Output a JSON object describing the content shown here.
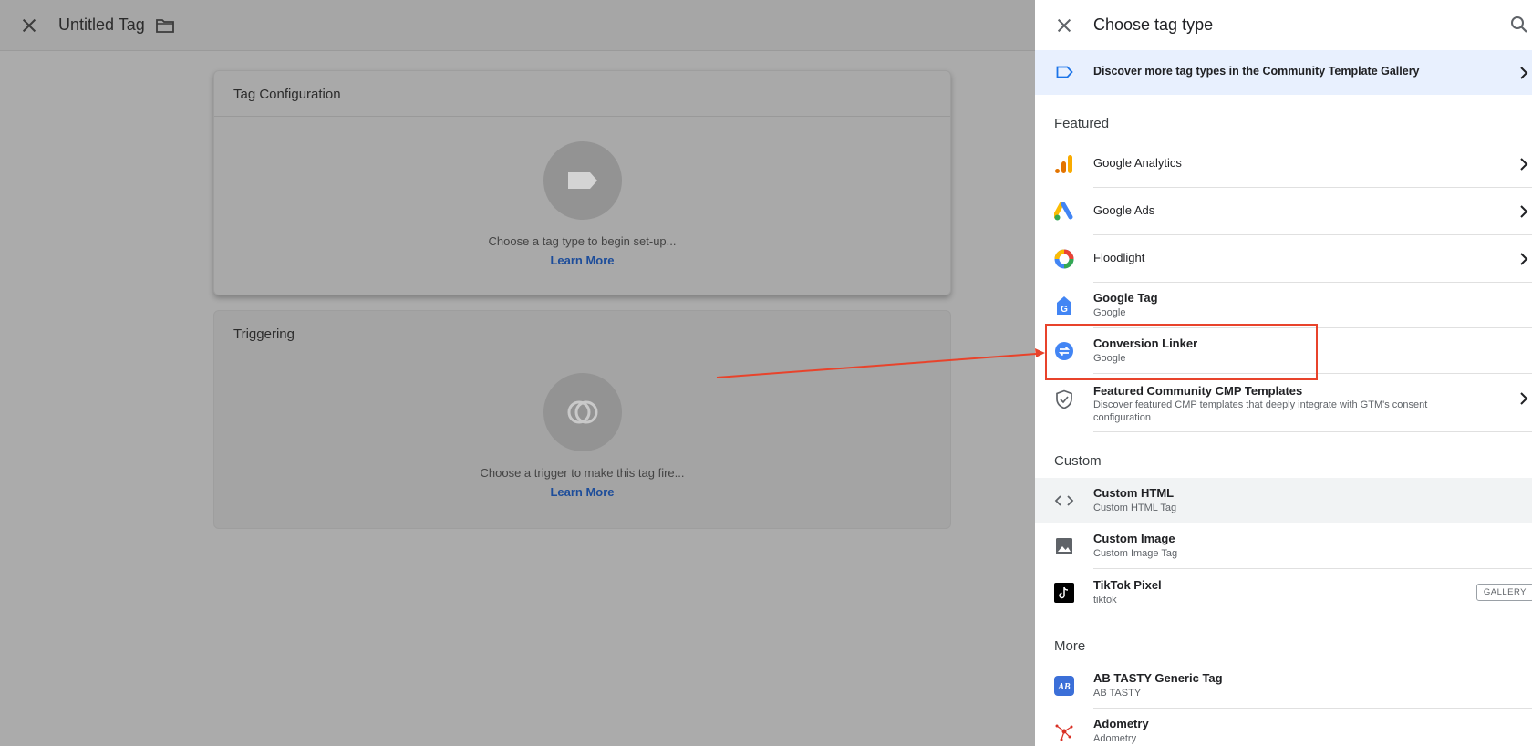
{
  "editor": {
    "title": "Untitled Tag",
    "config_card": {
      "title": "Tag Configuration",
      "hint": "Choose a tag type to begin set-up...",
      "link": "Learn More"
    },
    "trigger_card": {
      "title": "Triggering",
      "hint": "Choose a trigger to make this tag fire...",
      "link": "Learn More"
    }
  },
  "panel": {
    "title": "Choose tag type",
    "gallery_banner": "Discover more tag types in the Community Template Gallery",
    "sections": {
      "featured": "Featured",
      "custom": "Custom",
      "more": "More"
    },
    "featured_items": [
      {
        "name": "Google Analytics",
        "icon": "google-analytics-icon"
      },
      {
        "name": "Google Ads",
        "icon": "google-ads-icon"
      },
      {
        "name": "Floodlight",
        "icon": "floodlight-icon"
      },
      {
        "name": "Google Tag",
        "sub": "Google",
        "icon": "google-tag-icon"
      },
      {
        "name": "Conversion Linker",
        "sub": "Google",
        "icon": "conversion-linker-icon"
      },
      {
        "name": "Featured Community CMP Templates",
        "desc": "Discover featured CMP templates that deeply integrate with GTM's consent configuration",
        "icon": "shield-check-icon"
      }
    ],
    "custom_items": [
      {
        "name": "Custom HTML",
        "sub": "Custom HTML Tag",
        "icon": "code-icon"
      },
      {
        "name": "Custom Image",
        "sub": "Custom Image Tag",
        "icon": "image-icon"
      },
      {
        "name": "TikTok Pixel",
        "sub": "tiktok",
        "icon": "tiktok-icon",
        "badge": "GALLERY"
      }
    ],
    "more_items": [
      {
        "name": "AB TASTY Generic Tag",
        "sub": "AB TASTY",
        "icon": "ab-tasty-icon"
      },
      {
        "name": "Adometry",
        "sub": "Adometry",
        "icon": "adometry-icon"
      }
    ]
  },
  "colors": {
    "accent_blue": "#1a73e8",
    "annotation_red": "#e8432b",
    "banner_bg": "#e8f0fe"
  }
}
